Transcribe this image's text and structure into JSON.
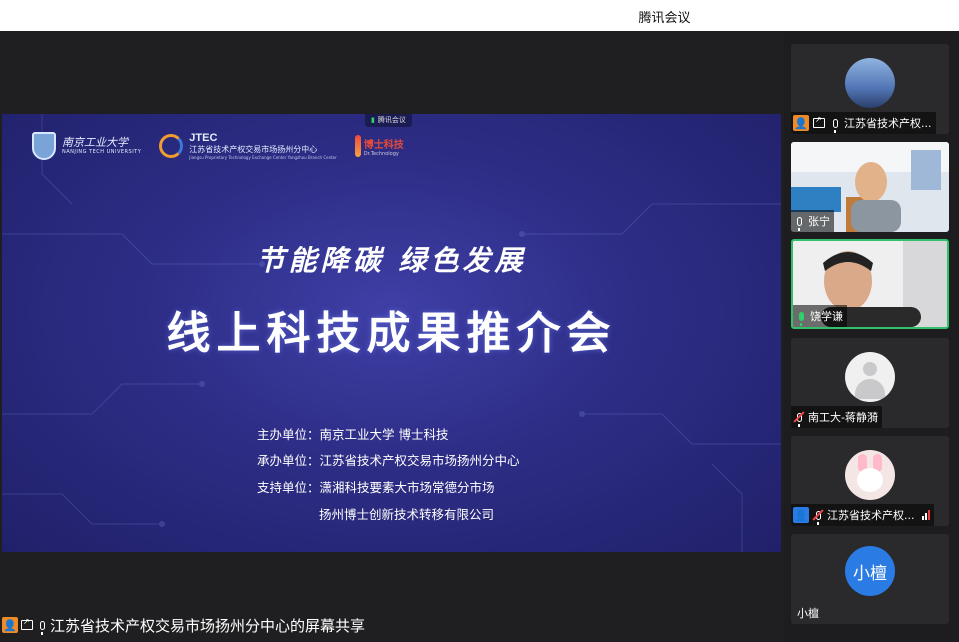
{
  "window": {
    "title": "腾讯会议"
  },
  "slide": {
    "top_badge": "腾讯会议",
    "logos": {
      "njtech_cn": "南京工业大学",
      "njtech_en": "NANJING TECH UNIVERSITY",
      "jtec_name": "JTEC",
      "jtec_cn": "江苏省技术产权交易市场扬州分中心",
      "jtec_en": "Jiangsu Proprietary Technology Exchange Center Yangzhou Branch Center",
      "dr_cn": "博士科技",
      "dr_en": "Dr.Technology"
    },
    "slogan": "节能降碳  绿色发展",
    "title": "线上科技成果推介会",
    "organizers": [
      {
        "key": "主办单位：",
        "value": "南京工业大学  博士科技"
      },
      {
        "key": "承办单位：",
        "value": "江苏省技术产权交易市场扬州分中心"
      },
      {
        "key": "支持单位：",
        "value": "潇湘科技要素大市场常德分市场"
      },
      {
        "key": "",
        "value": "扬州博士创新技术转移有限公司"
      }
    ]
  },
  "participants": [
    {
      "name": "江苏省技术产权...",
      "role": "host",
      "sharing": true,
      "mic": "on"
    },
    {
      "name": "张宁",
      "mic": "on"
    },
    {
      "name": "饶学谦",
      "mic": "speaking",
      "active": true
    },
    {
      "name": "南工大-蒋静漪",
      "mic": "muted"
    },
    {
      "name": "江苏省技术产权...",
      "role": "cohost",
      "mic": "muted"
    },
    {
      "name": "小檀",
      "avatar_text": "小檀"
    }
  ],
  "share_caption": "江苏省技术产权交易市场扬州分中心的屏幕共享",
  "colors": {
    "accent_green": "#2fc26a",
    "host_orange": "#f08a24",
    "cohost_blue": "#2a7be4",
    "slide_bg": "#2d2d86"
  }
}
